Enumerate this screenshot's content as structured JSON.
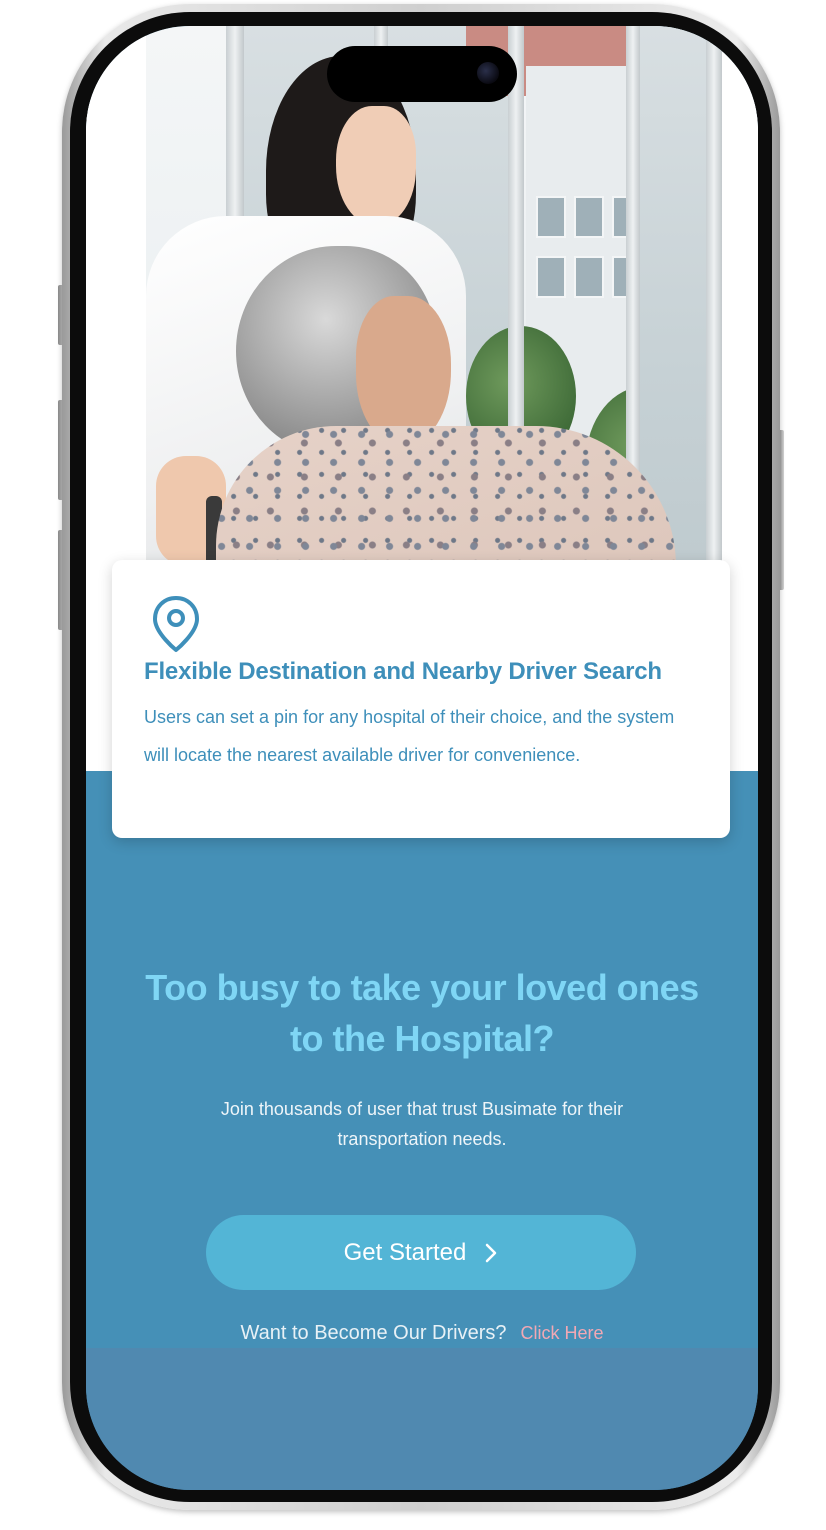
{
  "feature_card": {
    "icon": "location-pin-icon",
    "title": "Flexible Destination and Nearby Driver Search",
    "description": "Users can set a pin for any hospital of their choice, and the system will locate the nearest available driver for convenience."
  },
  "cta": {
    "heading": "Too busy to take your loved ones to the Hospital?",
    "subheading": "Join thousands of user that trust Busimate for their transportation needs.",
    "button_label": "Get Started",
    "button_icon": "chevron-right-icon"
  },
  "driver_signup": {
    "question": "Want to Become Our Drivers?",
    "link_label": "Click Here"
  },
  "colors": {
    "primary_blue": "#4590b7",
    "heading_cyan": "#7fd6f5",
    "button_blue": "#53b5d6",
    "link_pink": "#f2a8b4",
    "card_text": "#3e8fba"
  }
}
